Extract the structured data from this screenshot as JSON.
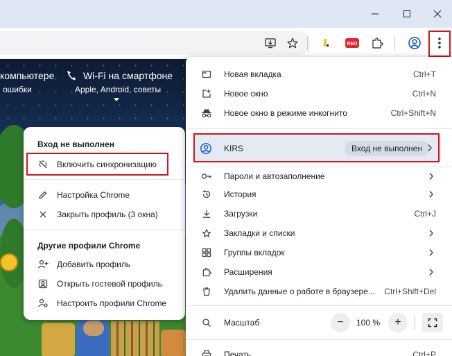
{
  "window": {
    "min_icon": "minimize-icon",
    "max_icon": "maximize-icon",
    "close_icon": "close-icon"
  },
  "toolbar": {
    "icons": [
      "install-app-icon",
      "bookmark-star-icon",
      "extension-yellow-icon",
      "extension-neo-icon",
      "extensions-puzzle-icon",
      "profile-icon",
      "more-vert-icon"
    ],
    "neo_label": "NEO"
  },
  "page": {
    "promo_left_title": "компьютере",
    "promo_left_sub": "ошибки",
    "promo_right_title": "Wi-Fi на смартфоне",
    "promo_right_sub": "Apple, Android, советы"
  },
  "profile_popup": {
    "header": "Вход не выполнен",
    "sync_label": "Включить синхронизацию",
    "customize_label": "Настройка Chrome",
    "close_profile_label": "Закрыть профиль (3 окна)",
    "other_profiles_header": "Другие профили Chrome",
    "add_profile_label": "Добавить профиль",
    "guest_label": "Открыть гостевой профиль",
    "manage_label": "Настроить профили Chrome"
  },
  "menu": {
    "new_tab": "Новая вкладка",
    "new_tab_sc": "Ctrl+T",
    "new_window": "Новое окно",
    "new_window_sc": "Ctrl+N",
    "incognito": "Новое окно в режиме инкогнито",
    "incognito_sc": "Ctrl+Shift+N",
    "profile_name": "KIRS",
    "profile_badge": "Вход не выполнен",
    "passwords": "Пароли и автозаполнение",
    "history": "История",
    "downloads": "Загрузки",
    "downloads_sc": "Ctrl+J",
    "bookmarks": "Закладки и списки",
    "tab_groups": "Группы вкладок",
    "extensions": "Расширения",
    "clear_data": "Удалить данные о работе в браузере...",
    "clear_data_sc": "Ctrl+Shift+Del",
    "zoom_label": "Масштаб",
    "zoom_value": "100 %",
    "zoom_minus": "−",
    "zoom_plus": "+",
    "print": "Печать...",
    "print_sc": "Ctrl+P"
  },
  "colors": {
    "highlight": "#d0141a",
    "accent": "#1a73e8"
  }
}
